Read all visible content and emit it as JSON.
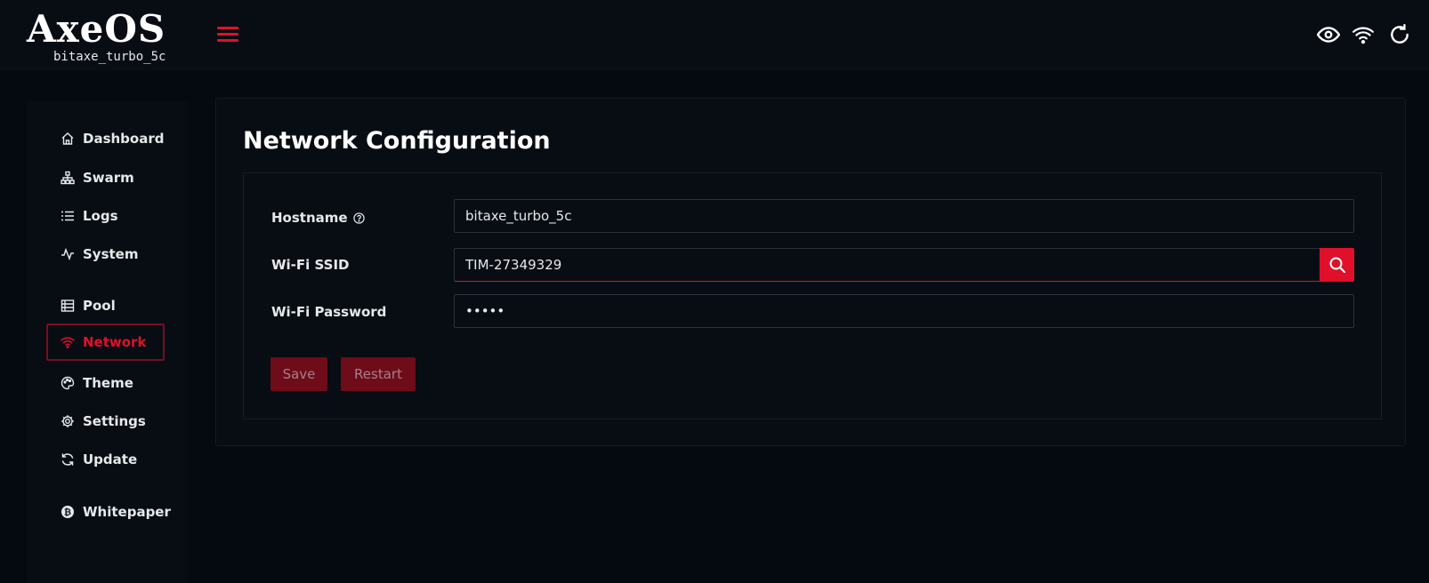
{
  "header": {
    "logo_text": "AxeOS",
    "hostname_label": "bitaxe_turbo_5c",
    "icons": [
      "eye-icon",
      "wifi-icon",
      "refresh-icon"
    ]
  },
  "sidebar": {
    "items": [
      {
        "label": "Dashboard",
        "icon": "home-icon",
        "active": false
      },
      {
        "label": "Swarm",
        "icon": "sitemap-icon",
        "active": false
      },
      {
        "label": "Logs",
        "icon": "list-icon",
        "active": false
      },
      {
        "label": "System",
        "icon": "activity-icon",
        "active": false
      },
      {
        "label": "Pool",
        "icon": "server-icon",
        "active": false
      },
      {
        "label": "Network",
        "icon": "wifi-icon",
        "active": true
      },
      {
        "label": "Theme",
        "icon": "palette-icon",
        "active": false
      },
      {
        "label": "Settings",
        "icon": "gear-icon",
        "active": false
      },
      {
        "label": "Update",
        "icon": "sync-icon",
        "active": false
      },
      {
        "label": "Whitepaper",
        "icon": "bitcoin-icon",
        "active": false
      }
    ]
  },
  "main": {
    "title": "Network Configuration",
    "form": {
      "hostname": {
        "label": "Hostname",
        "value": "bitaxe_turbo_5c"
      },
      "ssid": {
        "label": "Wi-Fi SSID",
        "value": "TIM-27349329"
      },
      "password": {
        "label": "Wi-Fi Password",
        "value": "•••••"
      }
    },
    "buttons": {
      "save": "Save",
      "restart": "Restart"
    }
  },
  "colors": {
    "accent": "#e0102a",
    "background": "#040a10",
    "surface": "#070d13"
  }
}
